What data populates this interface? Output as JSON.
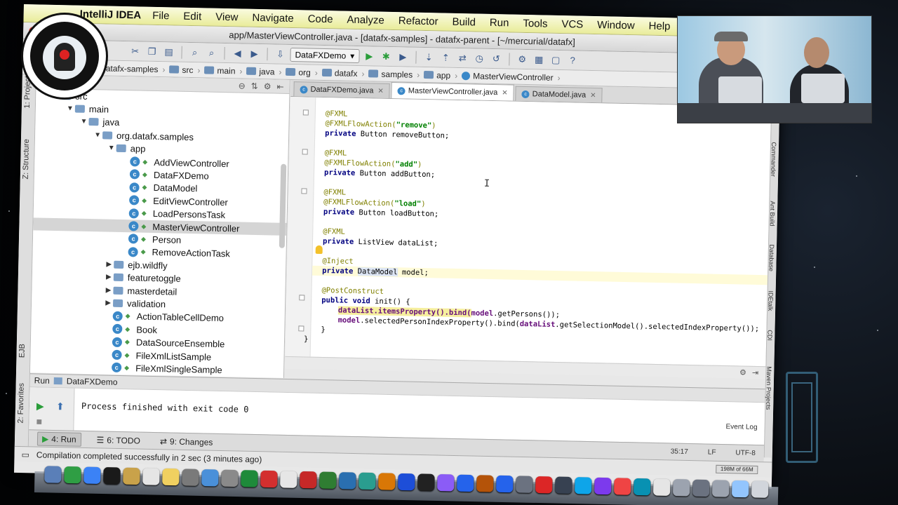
{
  "menubar": {
    "app_name": "IntelliJ IDEA",
    "menus": [
      "File",
      "Edit",
      "View",
      "Navigate",
      "Code",
      "Analyze",
      "Refactor",
      "Build",
      "Run",
      "Tools",
      "VCS",
      "Window",
      "Help"
    ]
  },
  "window": {
    "title": "app/MasterViewController.java - [datafx-samples] - datafx-parent - [~/mercurial/datafx]"
  },
  "toolbar": {
    "run_config": "DataFXDemo"
  },
  "breadcrumbs": [
    "datafx-samples",
    "src",
    "main",
    "java",
    "org",
    "datafx",
    "samples",
    "app",
    "MasterViewController"
  ],
  "left_stripe": {
    "project_tab": "1: Project",
    "structure_tab": "Z: Structure",
    "ejb_tab": "EJB",
    "favorites_tab": "2: Favorites"
  },
  "project_tree": [
    {
      "label": "src",
      "kind": "folder",
      "indent": 0,
      "expanded": true
    },
    {
      "label": "main",
      "kind": "folder",
      "indent": 1,
      "expanded": true
    },
    {
      "label": "java",
      "kind": "folder",
      "indent": 2,
      "expanded": true
    },
    {
      "label": "org.datafx.samples",
      "kind": "folder",
      "indent": 3,
      "expanded": true
    },
    {
      "label": "app",
      "kind": "folder",
      "indent": 4,
      "expanded": true
    },
    {
      "label": "AddViewController",
      "kind": "class",
      "indent": 5
    },
    {
      "label": "DataFXDemo",
      "kind": "class",
      "indent": 5
    },
    {
      "label": "DataModel",
      "kind": "class",
      "indent": 5
    },
    {
      "label": "EditViewController",
      "kind": "class",
      "indent": 5
    },
    {
      "label": "LoadPersonsTask",
      "kind": "class",
      "indent": 5
    },
    {
      "label": "MasterViewController",
      "kind": "class",
      "indent": 5,
      "selected": true
    },
    {
      "label": "Person",
      "kind": "class",
      "indent": 5
    },
    {
      "label": "RemoveActionTask",
      "kind": "class",
      "indent": 5
    },
    {
      "label": "ejb.wildfly",
      "kind": "folder",
      "indent": 4,
      "expanded": false
    },
    {
      "label": "featuretoggle",
      "kind": "folder",
      "indent": 4,
      "expanded": false
    },
    {
      "label": "masterdetail",
      "kind": "folder",
      "indent": 4,
      "expanded": false
    },
    {
      "label": "validation",
      "kind": "folder",
      "indent": 4,
      "expanded": false
    },
    {
      "label": "ActionTableCellDemo",
      "kind": "class",
      "indent": 4
    },
    {
      "label": "Book",
      "kind": "class",
      "indent": 4
    },
    {
      "label": "DataSourceEnsemble",
      "kind": "class",
      "indent": 4
    },
    {
      "label": "FileXmlListSample",
      "kind": "class",
      "indent": 4
    },
    {
      "label": "FileXmlSingleSample",
      "kind": "class",
      "indent": 4
    }
  ],
  "editor_tabs": [
    {
      "label": "DataFXDemo.java",
      "active": false
    },
    {
      "label": "MasterViewController.java",
      "active": true
    },
    {
      "label": "DataModel.java",
      "active": false
    }
  ],
  "code": {
    "l1": "@FXML",
    "l2_ann": "@FXMLFlowAction(",
    "l2_str": "\"remove\"",
    "l2_end": ")",
    "l3_kw": "private",
    "l3_rest": " Button removeButton;",
    "l4": "@FXML",
    "l5_ann": "@FXMLFlowAction(",
    "l5_str": "\"add\"",
    "l5_end": ")",
    "l6_kw": "private",
    "l6_rest": " Button addButton;",
    "l7": "@FXML",
    "l8_ann": "@FXMLFlowAction(",
    "l8_str": "\"load\"",
    "l8_end": ")",
    "l9_kw": "private",
    "l9_rest": " Button loadButton;",
    "l10": "@FXML",
    "l11_kw": "private",
    "l11_rest": " ListView dataList;",
    "l12": "@Inject",
    "l13_kw": "private",
    "l13_type": "DataModel",
    "l13_rest": " model;",
    "l14": "@PostConstruct",
    "l15_kw1": "public",
    "l15_kw2": "void",
    "l15_rest": " init() {",
    "l16_a": "dataList.itemsProperty().bind(",
    "l16_b": "model",
    "l16_c": ".getPersons());",
    "l17_a": "model",
    "l17_b": ".selectedPersonIndexProperty().bind(",
    "l17_c": "dataList",
    "l17_d": ".getSelectionModel().selectedIndexProperty());",
    "l18": "}",
    "l19": "}"
  },
  "right_stripe": [
    "Commander",
    "Ant Build",
    "Database",
    "IDEtalk",
    "CDI",
    "Maven Projects"
  ],
  "run_panel": {
    "tab_label": "Run",
    "config": "DataFXDemo",
    "output": "Process finished with exit code 0",
    "event_log": "Event Log"
  },
  "tool_buttons": [
    {
      "label": "4: Run",
      "active": true
    },
    {
      "label": "6: TODO",
      "active": false
    },
    {
      "label": "9: Changes",
      "active": false
    }
  ],
  "status_info": {
    "position": "35:17",
    "line_sep": "LF",
    "encoding": "UTF-8",
    "memory": "198M of 66M"
  },
  "statusbar": {
    "message": "Compilation completed successfully in 2 sec (3 minutes ago)"
  },
  "dock_colors": [
    "#5a7fb8",
    "#2f9e44",
    "#3b82f6",
    "#1a1a1a",
    "#c9a24a",
    "#e5e5e5",
    "#f0d060",
    "#7a7a7a",
    "#4a90d9",
    "#8a8a8a",
    "#1e8a3a",
    "#d32f2f",
    "#e6e6e6",
    "#c62828",
    "#2f7d32",
    "#2a6fb0",
    "#2a9d8f",
    "#d97706",
    "#1d4ed8",
    "#222222",
    "#8b5cf6",
    "#2563eb",
    "#b45309",
    "#2563eb",
    "#6b7280",
    "#dc2626",
    "#374151",
    "#0ea5e9",
    "#7c3aed",
    "#ef4444",
    "#0891b2",
    "#e5e5e5",
    "#9ca3af",
    "#6b7280",
    "#9ca3af",
    "#93c5fd",
    "#d1d5db"
  ]
}
